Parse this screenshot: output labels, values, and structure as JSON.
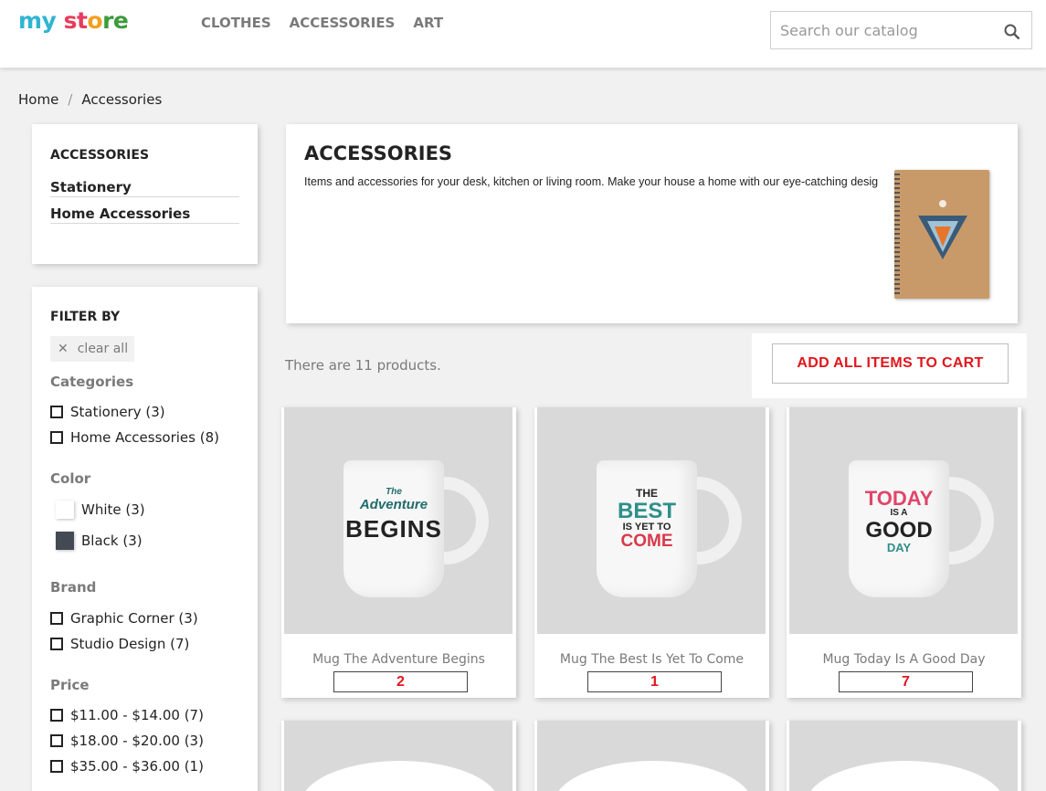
{
  "logo": {
    "part1": "my",
    "part2": " st",
    "part3": "o",
    "part4": "re"
  },
  "nav": [
    "CLOTHES",
    "ACCESSORIES",
    "ART"
  ],
  "search": {
    "placeholder": "Search our catalog"
  },
  "breadcrumb": {
    "home": "Home",
    "separator": "/",
    "current": "Accessories"
  },
  "category_block": {
    "title": "ACCESSORIES",
    "links": [
      "Stationery",
      "Home Accessories"
    ]
  },
  "filters": {
    "title": "FILTER BY",
    "clear_all": "clear all",
    "categories": {
      "title": "Categories",
      "items": [
        "Stationery (3)",
        "Home Accessories (8)"
      ]
    },
    "color": {
      "title": "Color",
      "items": [
        {
          "label": "White (3)",
          "color": "#ffffff"
        },
        {
          "label": "Black (3)",
          "color": "#434a54"
        }
      ]
    },
    "brand": {
      "title": "Brand",
      "items": [
        "Graphic Corner (3)",
        "Studio Design (7)"
      ]
    },
    "price": {
      "title": "Price",
      "items": [
        "$11.00 - $14.00 (7)",
        "$18.00 - $20.00 (3)",
        "$35.00 - $36.00 (1)"
      ]
    }
  },
  "category_header": {
    "title": "ACCESSORIES",
    "description": "Items and accessories for your desk, kitchen or living room. Make your house a home with our eye-catching designs."
  },
  "products_count": "There are 11 products.",
  "add_all_button": "ADD ALL ITEMS TO CART",
  "products": [
    {
      "name": "Mug The Adventure Begins",
      "qty": "2",
      "mug_lines": [
        "The",
        "Adventure",
        "BEGINS"
      ]
    },
    {
      "name": "Mug The Best Is Yet To Come",
      "qty": "1",
      "mug_lines": [
        "THE",
        "BEST",
        "IS YET TO",
        "COME"
      ]
    },
    {
      "name": "Mug Today Is A Good Day",
      "qty": "7",
      "mug_lines": [
        "TODAY",
        "IS A",
        "GOOD",
        "DAY"
      ]
    }
  ],
  "colors": {
    "accent_red": "#e0161d",
    "brand_blue": "#2fb5d2"
  }
}
